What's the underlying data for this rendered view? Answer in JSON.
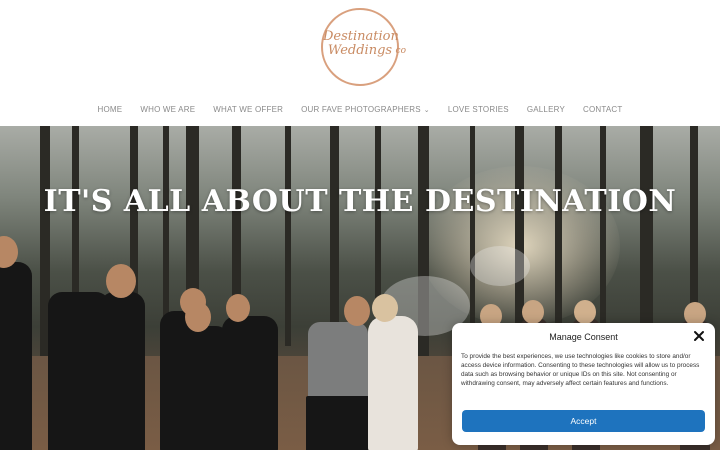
{
  "logo": {
    "line1": "Destination",
    "line2": "Weddings",
    "suffix": "co"
  },
  "nav": {
    "items": [
      {
        "label": "HOME"
      },
      {
        "label": "WHO WE ARE"
      },
      {
        "label": "WHAT WE OFFER"
      },
      {
        "label": "OUR FAVE PHOTOGRAPHERS",
        "has_dropdown": true
      },
      {
        "label": "LOVE STORIES"
      },
      {
        "label": "GALLERY"
      },
      {
        "label": "CONTACT"
      }
    ]
  },
  "hero": {
    "title": "IT'S ALL ABOUT THE DESTINATION",
    "image": "wedding-party-forest-photo"
  },
  "consent": {
    "title": "Manage Consent",
    "close_icon": "close-icon",
    "body": "To provide the best experiences, we use technologies like cookies to store and/or access device information. Consenting to these technologies will allow us to process data such as browsing behavior or unique IDs on this site. Not consenting or withdrawing consent, may adversely affect certain features and functions.",
    "accept_label": "Accept"
  },
  "colors": {
    "accent": "#1e73be",
    "logo": "#c98b63",
    "nav_text": "#8a8a8a"
  }
}
